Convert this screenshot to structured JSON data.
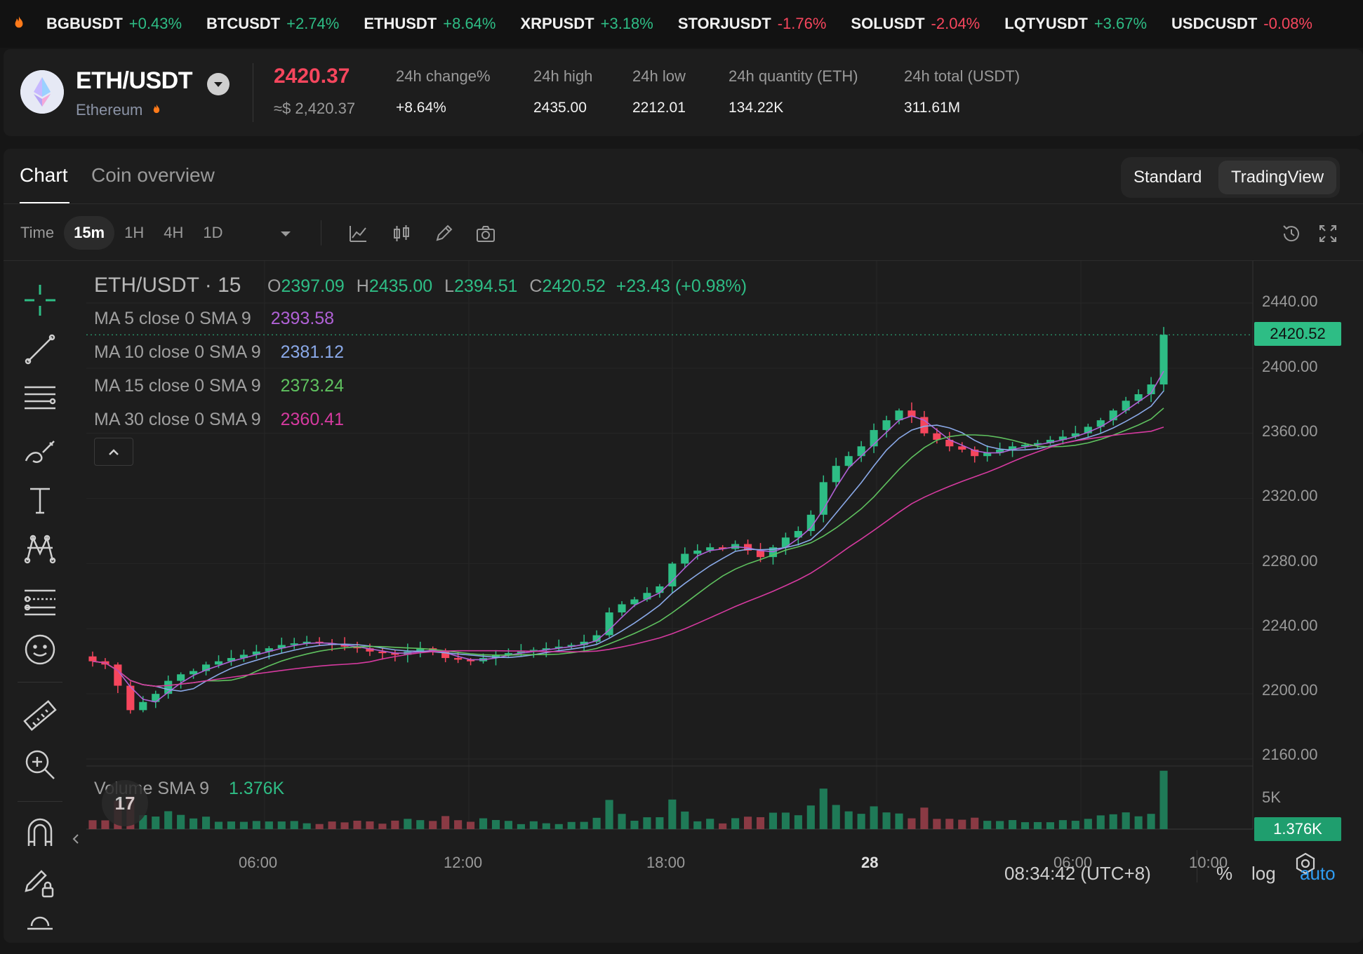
{
  "ticker": [
    {
      "symbol": "BGBUSDT",
      "change": "+0.43%",
      "dir": "up"
    },
    {
      "symbol": "BTCUSDT",
      "change": "+2.74%",
      "dir": "up"
    },
    {
      "symbol": "ETHUSDT",
      "change": "+8.64%",
      "dir": "up"
    },
    {
      "symbol": "XRPUSDT",
      "change": "+3.18%",
      "dir": "up"
    },
    {
      "symbol": "STORJUSDT",
      "change": "-1.76%",
      "dir": "down"
    },
    {
      "symbol": "SOLUSDT",
      "change": "-2.04%",
      "dir": "down"
    },
    {
      "symbol": "LQTYUSDT",
      "change": "+3.67%",
      "dir": "up"
    },
    {
      "symbol": "USDCUSDT",
      "change": "-0.08%",
      "dir": "down"
    }
  ],
  "header": {
    "pair": "ETH/USDT",
    "coin_name": "Ethereum",
    "last_price": "2420.37",
    "usd_price": "≈$ 2,420.37",
    "stats": [
      {
        "label": "24h change%",
        "value": "+8.64%",
        "color": "up"
      },
      {
        "label": "24h high",
        "value": "2435.00",
        "color": "plain"
      },
      {
        "label": "24h low",
        "value": "2212.01",
        "color": "plain"
      },
      {
        "label": "24h quantity (ETH)",
        "value": "134.22K",
        "color": "plain"
      },
      {
        "label": "24h total (USDT)",
        "value": "311.61M",
        "color": "plain"
      }
    ]
  },
  "tabs": {
    "chart": "Chart",
    "overview": "Coin overview"
  },
  "view_toggle": {
    "standard": "Standard",
    "tradingview": "TradingView",
    "selected": "TradingView"
  },
  "toolbar": {
    "time_label": "Time",
    "timeframes": [
      "15m",
      "1H",
      "4H",
      "1D"
    ],
    "active_timeframe": "15m"
  },
  "chart": {
    "symbol_label": "ETH/USDT · 15",
    "ohlc": {
      "o_label": "O",
      "o": "2397.09",
      "h_label": "H",
      "h": "2435.00",
      "l_label": "L",
      "l": "2394.51",
      "c_label": "C",
      "c": "2420.52",
      "change": "+23.43 (+0.98%)"
    },
    "ma": [
      {
        "label": "MA 5 close 0 SMA 9",
        "value": "2393.58",
        "color": "#b061d6"
      },
      {
        "label": "MA 10 close 0 SMA 9",
        "value": "2381.12",
        "color": "#8aa9e8"
      },
      {
        "label": "MA 15 close 0 SMA 9",
        "value": "2373.24",
        "color": "#5fc15f"
      },
      {
        "label": "MA 30 close 0 SMA 9",
        "value": "2360.41",
        "color": "#d63aa0"
      }
    ],
    "volume_label": "Volume SMA 9",
    "volume_value": "1.376K",
    "current_price_tag": "2420.52",
    "volume_tag": "1.376K",
    "y_axis": [
      "2440.00",
      "2400.00",
      "2360.00",
      "2320.00",
      "2280.00",
      "2240.00",
      "2200.00",
      "2160.00"
    ],
    "volume_axis": [
      "5K"
    ],
    "x_axis": [
      "06:00",
      "12:00",
      "18:00",
      "28",
      "06:00",
      "10:00"
    ],
    "clock": "08:34:42 (UTC+8)",
    "scale_options": {
      "percent": "%",
      "log": "log",
      "auto": "auto"
    }
  },
  "chart_data": {
    "type": "candlestick",
    "symbol": "ETH/USDT",
    "interval": "15",
    "ylim": [
      2160,
      2440
    ],
    "close_approx": [
      2220,
      2218,
      2205,
      2190,
      2195,
      2200,
      2208,
      2212,
      2214,
      2218,
      2220,
      2222,
      2224,
      2226,
      2228,
      2230,
      2231,
      2232,
      2231,
      2230,
      2229,
      2228,
      2226,
      2225,
      2224,
      2226,
      2228,
      2226,
      2222,
      2221,
      2220,
      2222,
      2224,
      2225,
      2226,
      2227,
      2228,
      2229,
      2230,
      2232,
      2236,
      2250,
      2255,
      2258,
      2262,
      2266,
      2280,
      2286,
      2288,
      2290,
      2289,
      2292,
      2288,
      2284,
      2290,
      2296,
      2300,
      2310,
      2330,
      2340,
      2346,
      2352,
      2362,
      2368,
      2374,
      2370,
      2360,
      2356,
      2352,
      2350,
      2346,
      2348,
      2350,
      2352,
      2353,
      2354,
      2356,
      2358,
      2360,
      2364,
      2368,
      2374,
      2380,
      2384,
      2390,
      2420.52
    ]
  }
}
